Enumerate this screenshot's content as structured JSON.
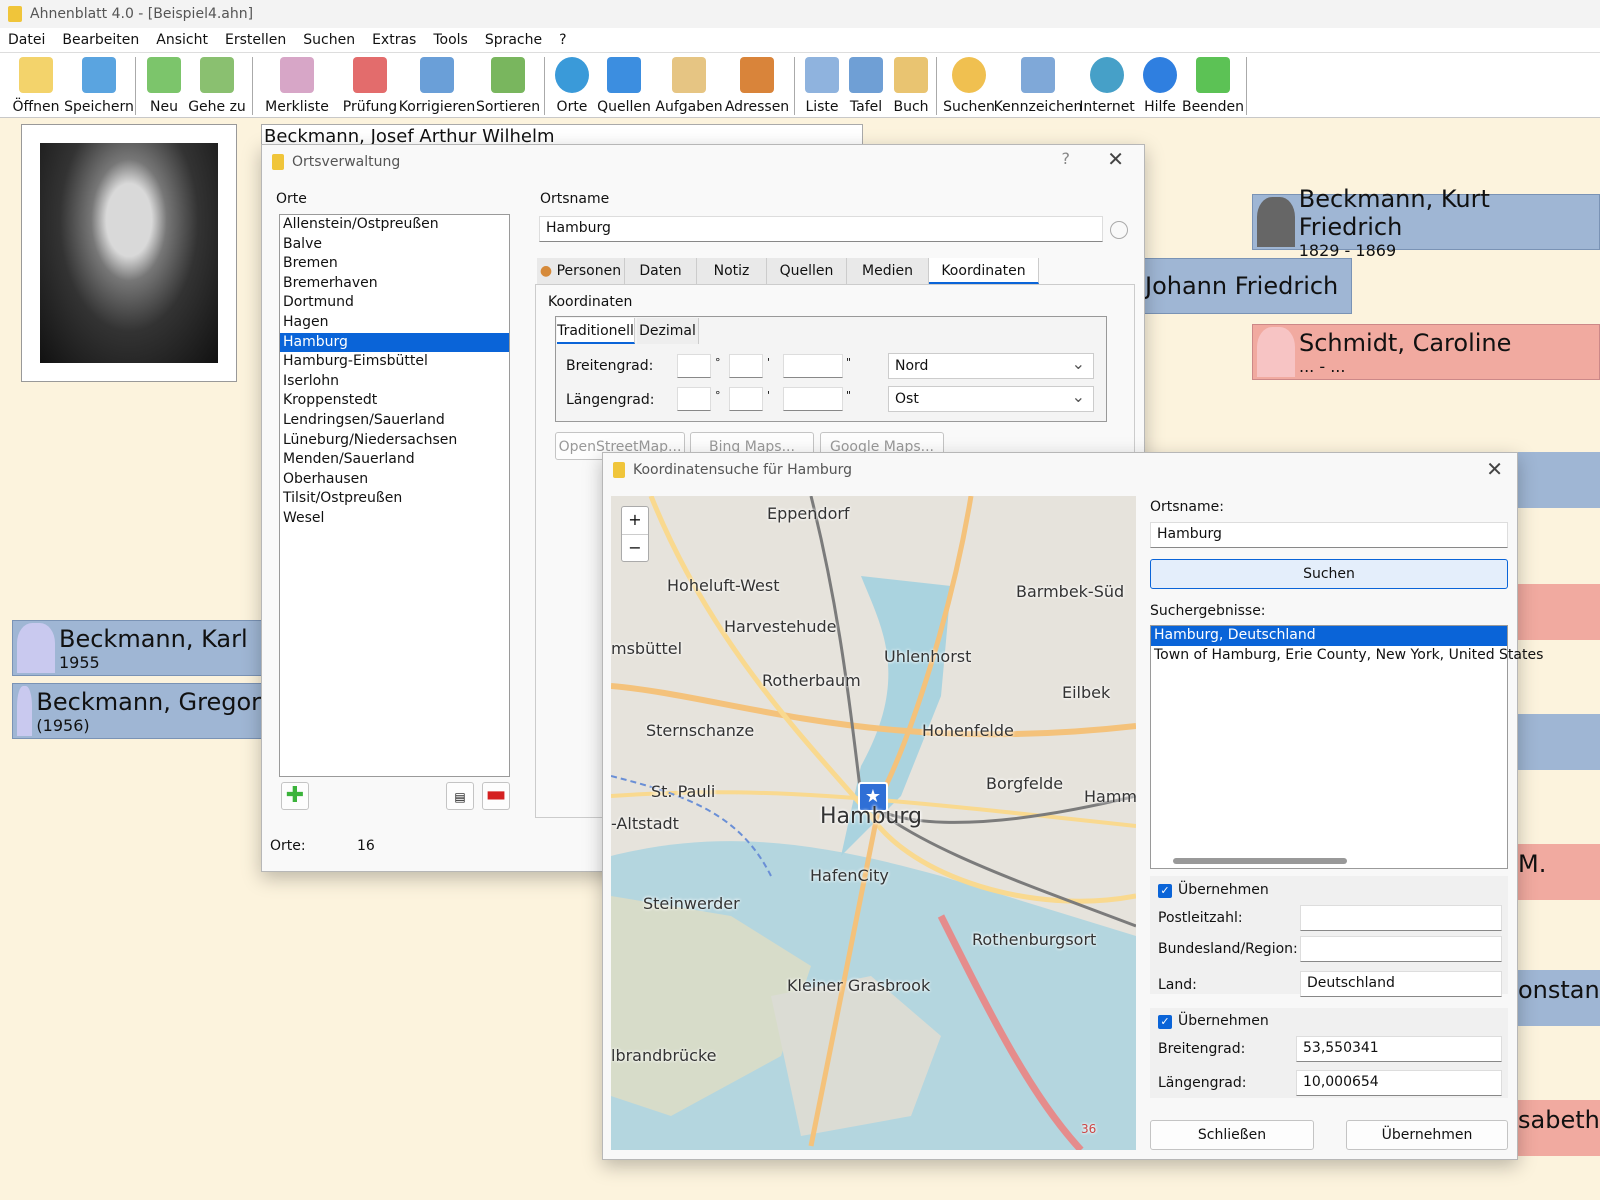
{
  "window": {
    "title": "Ahnenblatt 4.0 - [Beispiel4.ahn]"
  },
  "menu": [
    "Datei",
    "Bearbeiten",
    "Ansicht",
    "Erstellen",
    "Suchen",
    "Extras",
    "Tools",
    "Sprache",
    "?"
  ],
  "toolbar": [
    {
      "label": "Öffnen",
      "icon": "folder-open-icon",
      "color": "#f3d36b"
    },
    {
      "label": "Speichern",
      "icon": "save-icon",
      "color": "#5aa4e0"
    },
    {
      "label": "Neu",
      "icon": "new-person-icon",
      "color": "#7cc56b"
    },
    {
      "label": "Gehe zu",
      "icon": "goto-person-icon",
      "color": "#8ac070"
    },
    {
      "label": "Merkliste",
      "icon": "bookmark-list-icon",
      "color": "#d7a6c7"
    },
    {
      "label": "Prüfung",
      "icon": "check-clipboard-icon",
      "color": "#e36c6c"
    },
    {
      "label": "Korrigieren",
      "icon": "correct-icon",
      "color": "#6a9fd8"
    },
    {
      "label": "Sortieren",
      "icon": "sort-icon",
      "color": "#79b65e"
    },
    {
      "label": "Orte",
      "icon": "globe-icon",
      "color": "#3a9ad9"
    },
    {
      "label": "Quellen",
      "icon": "book-blue-icon",
      "color": "#3c8ee0"
    },
    {
      "label": "Aufgaben",
      "icon": "tasks-icon",
      "color": "#e6c583"
    },
    {
      "label": "Adressen",
      "icon": "address-book-icon",
      "color": "#d9843a"
    },
    {
      "label": "Liste",
      "icon": "list-icon",
      "color": "#8fb3de"
    },
    {
      "label": "Tafel",
      "icon": "tree-chart-icon",
      "color": "#6f9fd5"
    },
    {
      "label": "Buch",
      "icon": "open-book-icon",
      "color": "#e9c471"
    },
    {
      "label": "Suchen",
      "icon": "search-icon",
      "color": "#f0c050"
    },
    {
      "label": "Kennzeichen",
      "icon": "person-search-icon",
      "color": "#7fa8d8"
    },
    {
      "label": "Internet",
      "icon": "internet-globe-icon",
      "color": "#46a0c8"
    },
    {
      "label": "Hilfe",
      "icon": "help-icon",
      "color": "#2f7fe0"
    },
    {
      "label": "Beenden",
      "icon": "exit-icon",
      "color": "#5cc255"
    }
  ],
  "main": {
    "current_person": "Beckmann, Josef Arthur Wilhelm",
    "people": [
      {
        "name": "Beckmann, Kurt Friedrich",
        "dates": "1829 - 1869"
      },
      {
        "name": "Johann Friedrich",
        "dates": ""
      },
      {
        "name": "Schmidt, Caroline",
        "dates": "... - ..."
      },
      {
        "name": "Beckmann, Karl",
        "dates": "1955"
      },
      {
        "name": "Beckmann, Gregor",
        "dates": "(1956)"
      }
    ],
    "right_edge_fragments": [
      "M.",
      "onstant",
      "sabeth"
    ]
  },
  "orts": {
    "title": "Ortsverwaltung",
    "help": "?",
    "orte_label": "Orte",
    "places": [
      "Allenstein/Ostpreußen",
      "Balve",
      "Bremen",
      "Bremerhaven",
      "Dortmund",
      "Hagen",
      "Hamburg",
      "Hamburg-Eimsbüttel",
      "Iserlohn",
      "Kroppenstedt",
      "Lendringsen/Sauerland",
      "Lüneburg/Niedersachsen",
      "Menden/Sauerland",
      "Oberhausen",
      "Tilsit/Ostpreußen",
      "Wesel"
    ],
    "selected": "Hamburg",
    "ortsname_label": "Ortsname",
    "ortsname_value": "Hamburg",
    "tabs": [
      "Personen",
      "Daten",
      "Notiz",
      "Quellen",
      "Medien",
      "Koordinaten"
    ],
    "active_tab": "Koordinaten",
    "koordinaten_label": "Koordinaten",
    "subtabs": [
      "Traditionell",
      "Dezimal"
    ],
    "breitengrad_label": "Breitengrad:",
    "laengengrad_label": "Längengrad:",
    "lat_dir": "Nord",
    "lon_dir": "Ost",
    "map_buttons": [
      "OpenStreetMap...",
      "Bing Maps...",
      "Google Maps..."
    ],
    "count_label": "Orte:",
    "count_value": "16"
  },
  "koord": {
    "title": "Koordinatensuche für Hamburg",
    "ortsname_label": "Ortsname:",
    "ortsname_value": "Hamburg",
    "search_button": "Suchen",
    "results_label": "Suchergebnisse:",
    "results": [
      "Hamburg, Deutschland",
      "Town of Hamburg, Erie County, New York, United States"
    ],
    "uebernehmen1": "Übernehmen",
    "plz_label": "Postleitzahl:",
    "plz_value": "",
    "region_label": "Bundesland/Region:",
    "region_value": "",
    "land_label": "Land:",
    "land_value": "Deutschland",
    "uebernehmen2": "Übernehmen",
    "breitengrad_label": "Breitengrad:",
    "breitengrad_value": "53,550341",
    "laengengrad_label": "Längengrad:",
    "laengengrad_value": "10,000654",
    "close_button": "Schließen",
    "apply_button": "Übernehmen",
    "map": {
      "zoom_in": "+",
      "zoom_out": "−",
      "places": [
        "Eppendorf",
        "Hoheluft-West",
        "Barmbek-Süd",
        "Harvestehude",
        "msbüttel",
        "Uhlenhorst",
        "Rotherbaum",
        "Eilbek",
        "Sternschanze",
        "Hohenfelde",
        "St. Pauli",
        "Borgfelde",
        "Hamm",
        "Hamburg",
        "-Altstadt",
        "HafenCity",
        "Steinwerder",
        "Rothenburgsort",
        "Kleiner Grasbrook",
        "lbrandbrücke",
        "36"
      ]
    }
  }
}
